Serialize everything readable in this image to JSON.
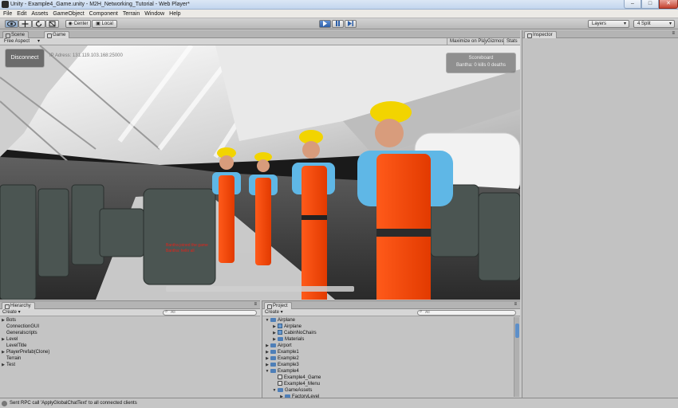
{
  "window": {
    "title": "Unity - Example4_Game.unity - M2H_Networking_Tutorial - Web Player*",
    "controls": [
      "–",
      "□",
      "✕"
    ]
  },
  "menu": [
    "File",
    "Edit",
    "Assets",
    "GameObject",
    "Component",
    "Terrain",
    "Window",
    "Help"
  ],
  "toolbar": {
    "pivot": "Center",
    "space": "Local",
    "layers": "Layers",
    "layout": "4 Split"
  },
  "view_tabs": [
    "Scene",
    "Game"
  ],
  "game_view": {
    "aspect": "Free Aspect",
    "options": [
      "Maximize on Play",
      "Gizmos",
      "Stats"
    ],
    "disconnect_label": "Disconnect",
    "connection_text": "IP Adress: 131.119.103.168:25000",
    "scoreboard_title": "Scoreboard",
    "scoreboard_line": "Bantha: 0 kills 0 deaths",
    "chat_lines": [
      "Bantha joined the game",
      "Bantha: hello all"
    ]
  },
  "inspector": {
    "title": "Inspector"
  },
  "hierarchy": {
    "title": "Hierarchy",
    "create_label": "Create",
    "search_placeholder": "All",
    "items": [
      {
        "label": "Bots",
        "expandable": true
      },
      {
        "label": "ConnectionGUI",
        "expandable": false
      },
      {
        "label": "Generalscripts",
        "expandable": false
      },
      {
        "label": "Level",
        "expandable": true
      },
      {
        "label": "LevelTitle",
        "expandable": false
      },
      {
        "label": "PlayerPrefab(Clone)",
        "expandable": true
      },
      {
        "label": "Terrain",
        "expandable": false
      },
      {
        "label": "Test",
        "expandable": true
      }
    ]
  },
  "project": {
    "title": "Project",
    "create_label": "Create",
    "search_placeholder": "All",
    "items": [
      {
        "label": "Airplane",
        "depth": 0,
        "kind": "folder",
        "arrow": "open"
      },
      {
        "label": "Airplane",
        "depth": 1,
        "kind": "prefab",
        "arrow": "closed"
      },
      {
        "label": "CabinNoChairs",
        "depth": 1,
        "kind": "prefab",
        "arrow": "closed"
      },
      {
        "label": "Materials",
        "depth": 1,
        "kind": "folder",
        "arrow": "closed"
      },
      {
        "label": "Airport",
        "depth": 0,
        "kind": "folder",
        "arrow": "closed"
      },
      {
        "label": "Example1",
        "depth": 0,
        "kind": "folder",
        "arrow": "closed"
      },
      {
        "label": "Example2",
        "depth": 0,
        "kind": "folder",
        "arrow": "closed"
      },
      {
        "label": "Example3",
        "depth": 0,
        "kind": "folder",
        "arrow": "closed"
      },
      {
        "label": "Example4",
        "depth": 0,
        "kind": "folder",
        "arrow": "open"
      },
      {
        "label": "Example4_Game",
        "depth": 1,
        "kind": "scene",
        "arrow": "none"
      },
      {
        "label": "Example4_Menu",
        "depth": 1,
        "kind": "scene",
        "arrow": "none"
      },
      {
        "label": "GameAssets",
        "depth": 1,
        "kind": "folder",
        "arrow": "open"
      },
      {
        "label": "FactoryLevel",
        "depth": 2,
        "kind": "folder",
        "arrow": "closed"
      }
    ]
  },
  "status": {
    "message": "Sent RPC call 'ApplyGlobalChatText' to all connected clients"
  }
}
